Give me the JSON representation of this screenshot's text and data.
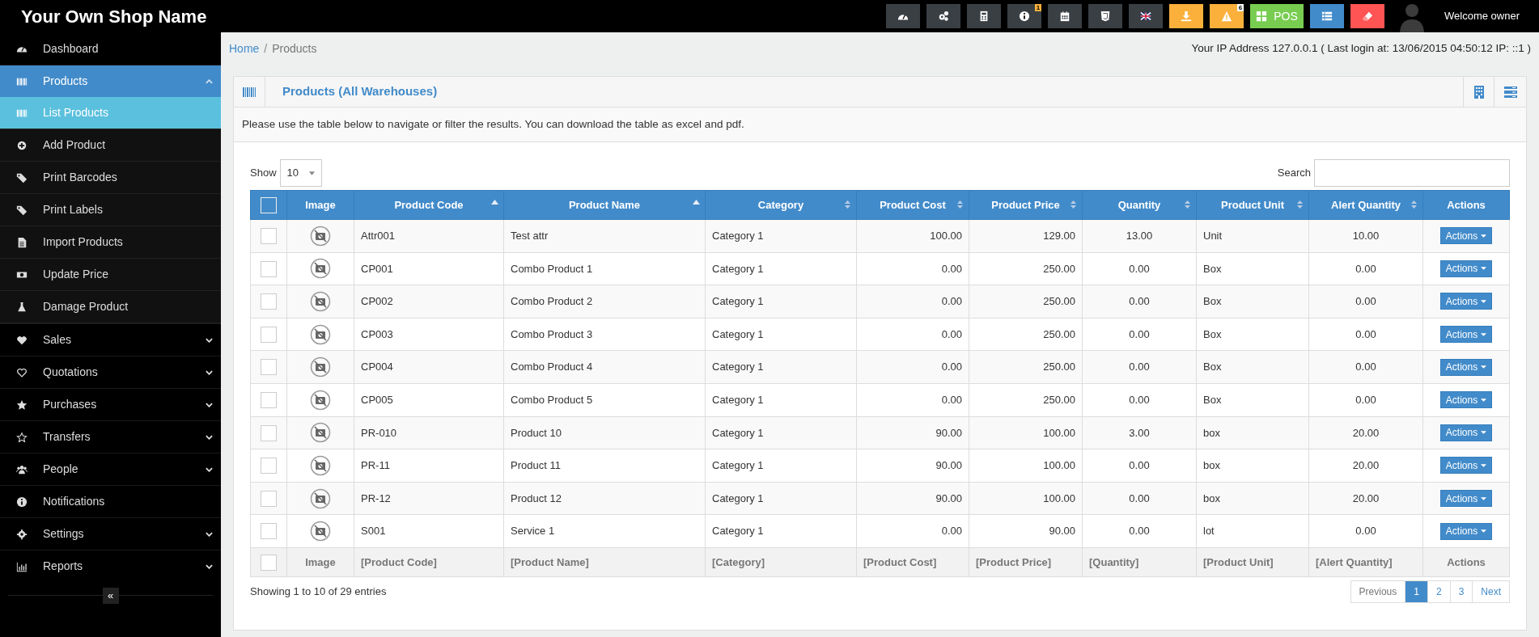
{
  "header": {
    "shop_name": "Your Own Shop Name",
    "buttons": [
      {
        "kind": "dashboard",
        "color": "#3a3f44"
      },
      {
        "kind": "cogs",
        "color": "#3a3f44"
      },
      {
        "kind": "calculator",
        "color": "#3a3f44"
      },
      {
        "kind": "info",
        "color": "#3a3f44",
        "badge": "1"
      },
      {
        "kind": "calendar",
        "color": "#3a3f44"
      },
      {
        "kind": "shield",
        "color": "#3a3f44"
      },
      {
        "kind": "flag",
        "color": "#3a3f44"
      },
      {
        "kind": "download",
        "color": "#fbb03b"
      },
      {
        "kind": "warning",
        "color": "#fbb03b",
        "badge": "6"
      },
      {
        "kind": "grid",
        "color": "#78cd51",
        "label": "POS"
      },
      {
        "kind": "list",
        "color": "#428bca"
      },
      {
        "kind": "eraser",
        "color": "#ff5454"
      }
    ],
    "user": "Welcome owner"
  },
  "sidebar": {
    "items": [
      {
        "label": "Dashboard",
        "kind": "dashboard",
        "selected": false
      },
      {
        "label": "Products",
        "kind": "barcode",
        "selected": true,
        "expanded": true,
        "children": [
          {
            "label": "List Products",
            "kind": "barcode",
            "selected": true
          },
          {
            "label": "Add Product",
            "kind": "plus",
            "selected": false
          },
          {
            "label": "Print Barcodes",
            "kind": "tags",
            "selected": false
          },
          {
            "label": "Print Labels",
            "kind": "tags",
            "selected": false
          },
          {
            "label": "Import Products",
            "kind": "file",
            "selected": false
          },
          {
            "label": "Update Price",
            "kind": "money",
            "selected": false
          },
          {
            "label": "Damage Product",
            "kind": "flask",
            "selected": false
          }
        ]
      },
      {
        "label": "Sales",
        "kind": "heart",
        "selected": false,
        "expanded": false
      },
      {
        "label": "Quotations",
        "kind": "heart-outline",
        "selected": false,
        "expanded": false
      },
      {
        "label": "Purchases",
        "kind": "star",
        "selected": false,
        "expanded": false
      },
      {
        "label": "Transfers",
        "kind": "star-outline",
        "selected": false,
        "expanded": false
      },
      {
        "label": "People",
        "kind": "users",
        "selected": false,
        "expanded": false
      },
      {
        "label": "Notifications",
        "kind": "info",
        "selected": false
      },
      {
        "label": "Settings",
        "kind": "cog",
        "selected": false,
        "expanded": false
      },
      {
        "label": "Reports",
        "kind": "chart",
        "selected": false,
        "expanded": false
      }
    ],
    "collapse": "«"
  },
  "breadcrumb": {
    "separator": "/",
    "items": [
      {
        "label": "Home",
        "link": true
      },
      {
        "label": "Products",
        "link": false
      }
    ]
  },
  "login_info": "Your IP Address 127.0.0.1 ( Last login at: 13/06/2015 04:50:12 IP: ::1 )",
  "panel": {
    "title": "Products (All Warehouses)",
    "intro": "Please use the table below to navigate or filter the results. You can download the table as excel and pdf.",
    "show_label": "Show",
    "page_size": "10",
    "search_label": "Search",
    "table": {
      "header_checkbox": {
        "checked": false
      },
      "columns": [
        {
          "kind": "check"
        },
        {
          "label": "Image",
          "kind": "image"
        },
        {
          "label": "Product Code",
          "kind": "text",
          "sorted": true
        },
        {
          "label": "Product Name",
          "kind": "text",
          "sorted": true
        },
        {
          "label": "Category",
          "kind": "text",
          "sorted": false
        },
        {
          "label": "Product Cost",
          "kind": "number",
          "sorted": false
        },
        {
          "label": "Product Price",
          "kind": "number",
          "sorted": false
        },
        {
          "label": "Quantity",
          "kind": "center",
          "sorted": false
        },
        {
          "label": "Product Unit",
          "kind": "text",
          "sorted": false
        },
        {
          "label": "Alert Quantity",
          "kind": "center",
          "sorted": false
        },
        {
          "label": "Actions",
          "kind": "actions"
        }
      ],
      "rows": [
        {
          "checked": false,
          "cells": [
            null,
            null,
            "Attr001",
            "Test attr",
            "Category 1",
            "100.00",
            "129.00",
            "13.00",
            "Unit",
            "10.00",
            "Actions"
          ]
        },
        {
          "checked": false,
          "cells": [
            null,
            null,
            "CP001",
            "Combo Product 1",
            "Category 1",
            "0.00",
            "250.00",
            "0.00",
            "Box",
            "0.00",
            "Actions"
          ]
        },
        {
          "checked": false,
          "cells": [
            null,
            null,
            "CP002",
            "Combo Product 2",
            "Category 1",
            "0.00",
            "250.00",
            "0.00",
            "Box",
            "0.00",
            "Actions"
          ]
        },
        {
          "checked": false,
          "cells": [
            null,
            null,
            "CP003",
            "Combo Product 3",
            "Category 1",
            "0.00",
            "250.00",
            "0.00",
            "Box",
            "0.00",
            "Actions"
          ]
        },
        {
          "checked": false,
          "cells": [
            null,
            null,
            "CP004",
            "Combo Product 4",
            "Category 1",
            "0.00",
            "250.00",
            "0.00",
            "Box",
            "0.00",
            "Actions"
          ]
        },
        {
          "checked": false,
          "cells": [
            null,
            null,
            "CP005",
            "Combo Product 5",
            "Category 1",
            "0.00",
            "250.00",
            "0.00",
            "Box",
            "0.00",
            "Actions"
          ]
        },
        {
          "checked": false,
          "cells": [
            null,
            null,
            "PR-010",
            "Product 10",
            "Category 1",
            "90.00",
            "100.00",
            "3.00",
            "box",
            "20.00",
            "Actions"
          ]
        },
        {
          "checked": false,
          "cells": [
            null,
            null,
            "PR-11",
            "Product 11",
            "Category 1",
            "90.00",
            "100.00",
            "0.00",
            "box",
            "20.00",
            "Actions"
          ]
        },
        {
          "checked": false,
          "cells": [
            null,
            null,
            "PR-12",
            "Product 12",
            "Category 1",
            "90.00",
            "100.00",
            "0.00",
            "box",
            "20.00",
            "Actions"
          ]
        },
        {
          "checked": false,
          "cells": [
            null,
            null,
            "S001",
            "Service 1",
            "Category 1",
            "0.00",
            "90.00",
            "0.00",
            "lot",
            "0.00",
            "Actions"
          ]
        }
      ],
      "footer_row": {
        "checked": false,
        "cells": [
          null,
          "Image",
          "[Product Code]",
          "[Product Name]",
          "[Category]",
          "[Product Cost]",
          "[Product Price]",
          "[Quantity]",
          "[Product Unit]",
          "[Alert Quantity]",
          "Actions"
        ]
      }
    },
    "info": "Showing 1 to 10 of 29 entries",
    "pagination": [
      {
        "label": "Previous",
        "selected": false
      },
      {
        "label": "1",
        "selected": true
      },
      {
        "label": "2",
        "selected": false
      },
      {
        "label": "3",
        "selected": false
      },
      {
        "label": "Next",
        "selected": false
      }
    ]
  }
}
